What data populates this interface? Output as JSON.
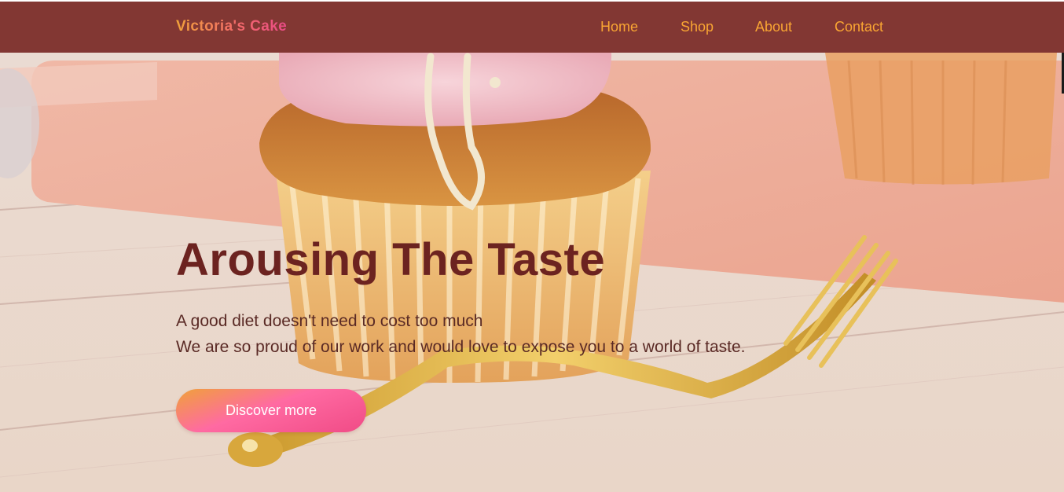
{
  "header": {
    "brand": "Victoria's Cake",
    "nav": [
      {
        "label": "Home"
      },
      {
        "label": "Shop"
      },
      {
        "label": "About"
      },
      {
        "label": "Contact"
      }
    ]
  },
  "hero": {
    "title": "Arousing The Taste",
    "subtitle_line1": "A good diet doesn't need to cost too much",
    "subtitle_line2": "We are so proud of our work and would love to expose you to a world of taste.",
    "cta_label": "Discover more",
    "background_image": "cupcake-with-pink-frosting-and-golden-fork"
  },
  "colors": {
    "header_bg": "#823733",
    "nav_text": "#f9a533",
    "title_text": "#6c2320",
    "cta_gradient_start": "#f0a13a",
    "cta_gradient_end": "#f04b86"
  }
}
